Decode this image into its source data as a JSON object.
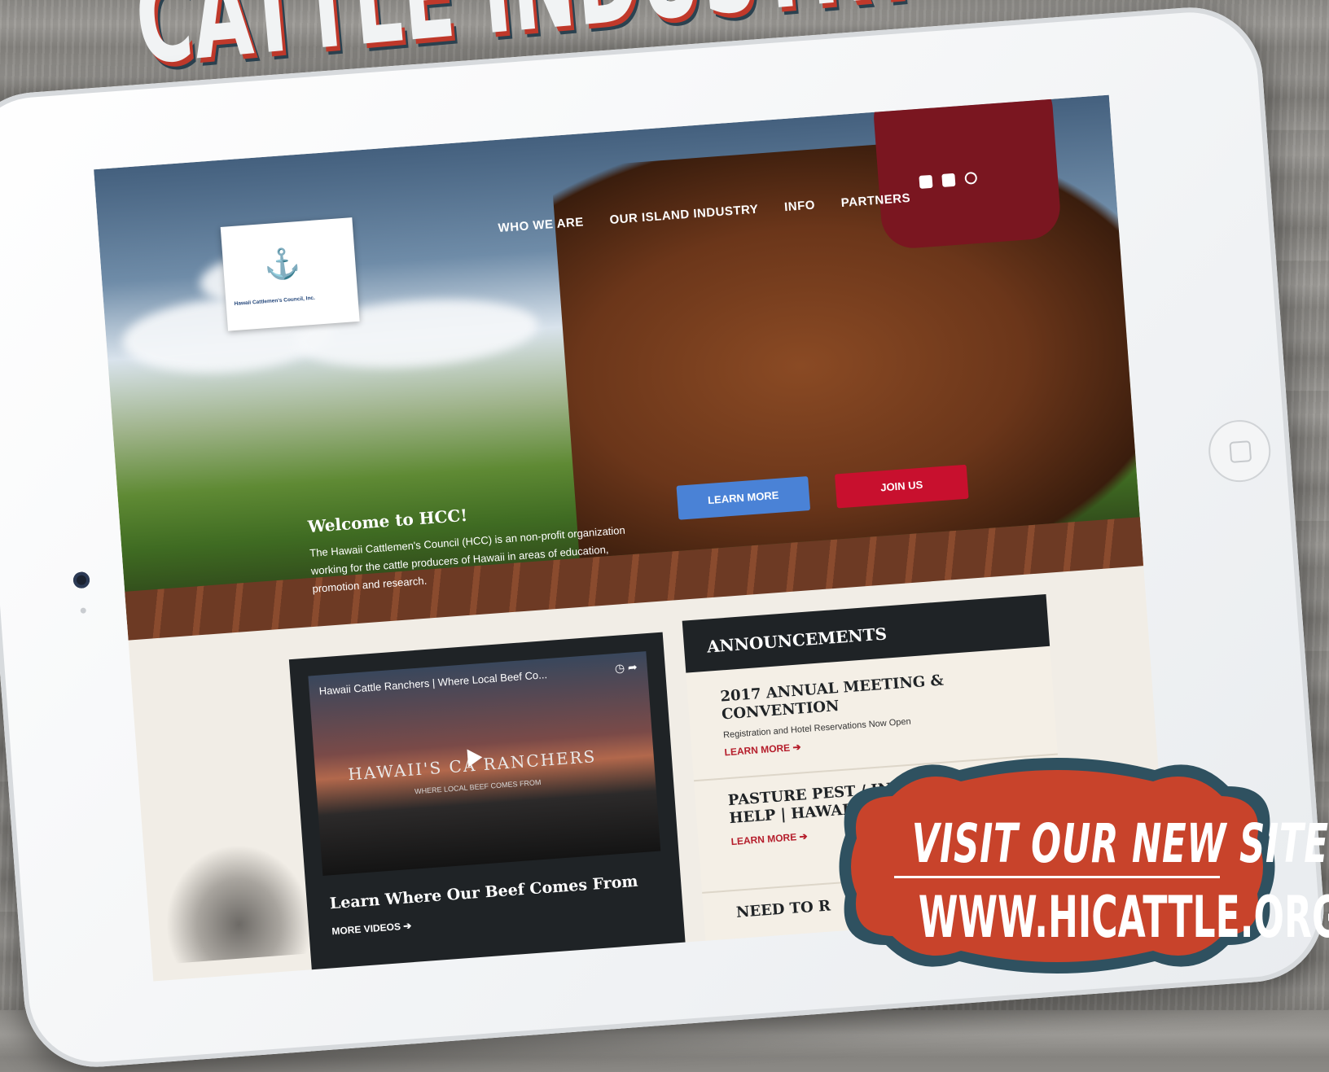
{
  "headline": "CATTLE INDUSTRY N",
  "site": {
    "logo_text": "Hawaii Cattlemen's Council, Inc.",
    "nav": [
      "WHO WE ARE",
      "OUR ISLAND INDUSTRY",
      "INFO",
      "PARTNERS"
    ],
    "icons": [
      "facebook-icon",
      "youtube-icon",
      "search-icon"
    ],
    "hero": {
      "title": "Welcome to HCC!",
      "text": "The Hawaii Cattlemen's Council (HCC) is an non-profit organization working for the cattle producers of Hawaii in areas of education, promotion and research.",
      "learn_more": "LEARN MORE",
      "join_us": "JOIN US"
    },
    "video": {
      "title": "Hawaii Cattle Ranchers | Where Local Beef Co...",
      "watermark": "HAWAII'S CA   RANCHERS",
      "watermark_sub": "WHERE LOCAL BEEF COMES FROM",
      "caption": "Learn Where Our Beef Comes From",
      "more": "MORE VIDEOS ➔"
    },
    "announcements": {
      "heading": "ANNOUNCEMENTS",
      "items": [
        {
          "title": "2017 ANNUAL MEETING & CONVENTION",
          "text": "Registration and Hotel Reservations Now Open",
          "link": "LEARN MORE ➔"
        },
        {
          "title": "PASTURE PEST / INVASIVE SPECIES HELP | HAWAII RANGELANDS",
          "text": "",
          "link": "LEARN MORE ➔"
        },
        {
          "title": "NEED TO R",
          "text": "",
          "link": ""
        }
      ]
    }
  },
  "badge": {
    "line1": "VISIT OUR NEW SITE:",
    "line2": "WWW.HICATTLE.ORG",
    "fill": "#c8432b",
    "border": "#2f5160"
  }
}
